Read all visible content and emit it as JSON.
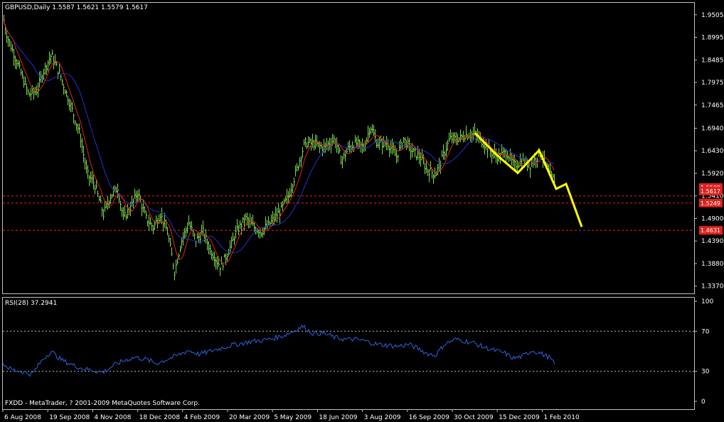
{
  "header": {
    "symbol_line": "GBPUSD,Daily  1.5587 1.5621 1.5579 1.5617"
  },
  "rsi_panel": {
    "label": "RSI(28) 37.2941",
    "axis_labels": [
      "100",
      "70",
      "30",
      "0"
    ]
  },
  "footer": {
    "copyright": "FXDD - MetaTrader, ? 2001-2009 MetaQuotes Software Corp."
  },
  "colors": {
    "background": "#000000",
    "frame": "#c0c0c0",
    "bars": "#7fd94a",
    "ma_fast": "#e0231c",
    "ma_slow": "#2030d0",
    "forecast": "#ffff00",
    "level": "#e0231c",
    "rsi": "#2d63e0"
  },
  "chart_data": [
    {
      "type": "line",
      "title": "GBPUSD,Daily  1.5587 1.5621 1.5579 1.5617",
      "x": [
        "6 Aug 2008",
        "19 Sep 2008",
        "4 Nov 2008",
        "18 Dec 2008",
        "4 Feb 2009",
        "20 Mar 2009",
        "5 May 2009",
        "18 Jun 2009",
        "3 Aug 2009",
        "16 Sep 2009",
        "30 Oct 2009",
        "15 Dec 2009",
        "1 Feb 2010"
      ],
      "y_ticks": [
        "1.9505",
        "1.8995",
        "1.8485",
        "1.7975",
        "1.7465",
        "1.6940",
        "1.6430",
        "1.5920",
        "1.5410",
        "1.4900",
        "1.4390",
        "1.3880",
        "1.3370"
      ],
      "ylim": [
        1.3205,
        1.9775
      ],
      "price_path": [
        [
          0,
          1.975
        ],
        [
          10,
          1.9
        ],
        [
          22,
          1.85
        ],
        [
          40,
          1.77
        ],
        [
          52,
          1.78
        ],
        [
          60,
          1.82
        ],
        [
          72,
          1.86
        ],
        [
          85,
          1.81
        ],
        [
          100,
          1.74
        ],
        [
          112,
          1.68
        ],
        [
          122,
          1.59
        ],
        [
          132,
          1.57
        ],
        [
          145,
          1.5
        ],
        [
          155,
          1.54
        ],
        [
          165,
          1.56
        ],
        [
          173,
          1.49
        ],
        [
          185,
          1.52
        ],
        [
          193,
          1.55
        ],
        [
          205,
          1.49
        ],
        [
          215,
          1.47
        ],
        [
          225,
          1.5
        ],
        [
          235,
          1.46
        ],
        [
          245,
          1.37
        ],
        [
          255,
          1.44
        ],
        [
          265,
          1.48
        ],
        [
          275,
          1.44
        ],
        [
          285,
          1.46
        ],
        [
          295,
          1.42
        ],
        [
          310,
          1.38
        ],
        [
          322,
          1.42
        ],
        [
          332,
          1.46
        ],
        [
          345,
          1.49
        ],
        [
          357,
          1.47
        ],
        [
          367,
          1.46
        ],
        [
          380,
          1.48
        ],
        [
          395,
          1.51
        ],
        [
          405,
          1.54
        ],
        [
          415,
          1.59
        ],
        [
          428,
          1.66
        ],
        [
          440,
          1.66
        ],
        [
          455,
          1.65
        ],
        [
          470,
          1.67
        ],
        [
          480,
          1.62
        ],
        [
          490,
          1.65
        ],
        [
          500,
          1.66
        ],
        [
          512,
          1.65
        ],
        [
          520,
          1.7
        ],
        [
          530,
          1.66
        ],
        [
          545,
          1.66
        ],
        [
          557,
          1.63
        ],
        [
          567,
          1.67
        ],
        [
          580,
          1.64
        ],
        [
          590,
          1.63
        ],
        [
          600,
          1.6
        ],
        [
          612,
          1.59
        ],
        [
          620,
          1.62
        ],
        [
          632,
          1.67
        ],
        [
          645,
          1.67
        ],
        [
          655,
          1.68
        ],
        [
          668,
          1.68
        ],
        [
          680,
          1.66
        ],
        [
          690,
          1.64
        ],
        [
          700,
          1.63
        ],
        [
          712,
          1.64
        ],
        [
          722,
          1.61
        ],
        [
          735,
          1.62
        ],
        [
          745,
          1.61
        ],
        [
          760,
          1.64
        ],
        [
          772,
          1.59
        ],
        [
          780,
          1.575
        ]
      ],
      "forecast_path": [
        [
          668,
          1.683
        ],
        [
          698,
          1.634
        ],
        [
          728,
          1.593
        ],
        [
          758,
          1.644
        ],
        [
          782,
          1.557
        ],
        [
          796,
          1.568
        ],
        [
          818,
          1.471
        ]
      ],
      "level_lines": [
        {
          "value": 1.541,
          "label": "1.5410",
          "line_only": true
        },
        {
          "value": 1.5249,
          "label": "1.5249",
          "line_only": false
        },
        {
          "value": 1.4631,
          "label": "1.4631",
          "line_only": false
        }
      ],
      "level_tags_top": [
        "1.5509",
        "1.5617"
      ]
    },
    {
      "type": "line",
      "title": "RSI(28) 37.2941",
      "ylim": [
        0,
        100
      ],
      "y_ticks": [
        "100",
        "70",
        "30",
        "0"
      ],
      "levels": [
        70,
        30
      ],
      "rsi_path": [
        [
          0,
          40
        ],
        [
          15,
          32
        ],
        [
          30,
          30
        ],
        [
          45,
          27
        ],
        [
          60,
          42
        ],
        [
          72,
          50
        ],
        [
          85,
          42
        ],
        [
          100,
          37
        ],
        [
          115,
          33
        ],
        [
          130,
          31
        ],
        [
          145,
          29
        ],
        [
          160,
          36
        ],
        [
          175,
          41
        ],
        [
          190,
          44
        ],
        [
          205,
          42
        ],
        [
          220,
          38
        ],
        [
          235,
          42
        ],
        [
          250,
          46
        ],
        [
          265,
          51
        ],
        [
          280,
          47
        ],
        [
          295,
          50
        ],
        [
          310,
          53
        ],
        [
          325,
          56
        ],
        [
          340,
          58
        ],
        [
          355,
          60
        ],
        [
          370,
          61
        ],
        [
          385,
          63
        ],
        [
          400,
          66
        ],
        [
          412,
          70
        ],
        [
          425,
          75
        ],
        [
          440,
          68
        ],
        [
          455,
          68
        ],
        [
          470,
          64
        ],
        [
          485,
          62
        ],
        [
          500,
          62
        ],
        [
          515,
          60
        ],
        [
          530,
          57
        ],
        [
          545,
          56
        ],
        [
          560,
          55
        ],
        [
          575,
          57
        ],
        [
          590,
          52
        ],
        [
          600,
          48
        ],
        [
          612,
          46
        ],
        [
          625,
          57
        ],
        [
          640,
          62
        ],
        [
          655,
          60
        ],
        [
          668,
          58
        ],
        [
          680,
          54
        ],
        [
          695,
          51
        ],
        [
          710,
          48
        ],
        [
          722,
          43
        ],
        [
          735,
          45
        ],
        [
          748,
          51
        ],
        [
          760,
          48
        ],
        [
          772,
          44
        ],
        [
          780,
          37
        ]
      ]
    }
  ]
}
